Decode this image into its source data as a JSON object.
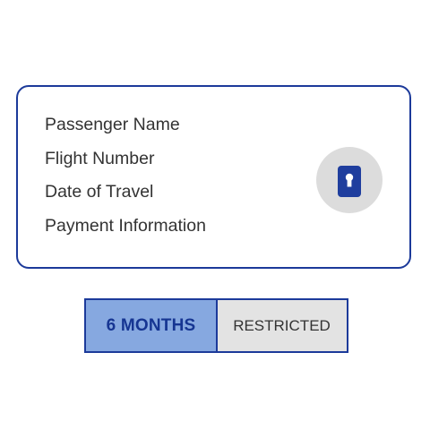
{
  "card": {
    "fields": [
      "Passenger Name",
      "Flight Number",
      "Date of Travel",
      "Payment Information"
    ],
    "icon": "secure-phone-lock-icon"
  },
  "retention": {
    "period": "6 MONTHS",
    "status": "RESTRICTED"
  },
  "colors": {
    "accent": "#1c3a9a",
    "period_fill": "#86a8e0",
    "status_fill": "#e3e3e3",
    "icon_circle": "#dcdcdc"
  }
}
